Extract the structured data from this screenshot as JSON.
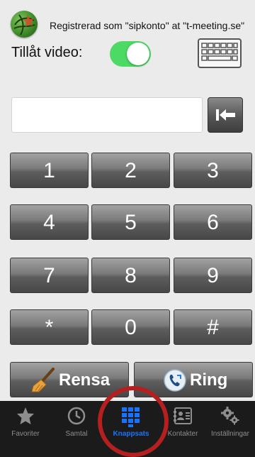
{
  "status": {
    "text": "Registrerad som \"sipkonto\" at \"t-meeting.se\"",
    "logo_icon": "globe-logo-icon"
  },
  "video": {
    "label": "Tillåt video:",
    "enabled": true,
    "toggle_color": "#4cd964"
  },
  "keyboard_icon": "keyboard-icon",
  "display": {
    "value": ""
  },
  "backspace_icon": "backspace-arrow-icon",
  "keypad": {
    "keys": [
      "1",
      "2",
      "3",
      "4",
      "5",
      "6",
      "7",
      "8",
      "9",
      "*",
      "0",
      "#"
    ]
  },
  "actions": {
    "clear_label": "Rensa",
    "clear_icon": "broom-icon",
    "call_label": "Ring",
    "call_icon": "phone-icon"
  },
  "tabs": [
    {
      "label": "Favoriter",
      "icon": "star-icon",
      "active": false
    },
    {
      "label": "Samtal",
      "icon": "clock-icon",
      "active": false
    },
    {
      "label": "Knappsats",
      "icon": "keypad-icon",
      "active": true
    },
    {
      "label": "Kontakter",
      "icon": "contacts-icon",
      "active": false
    },
    {
      "label": "Inställningar",
      "icon": "gears-icon",
      "active": false
    }
  ],
  "colors": {
    "tab_active": "#1a73ff",
    "tab_inactive": "#8e8e8e",
    "highlight_ring": "#b51f1f"
  }
}
